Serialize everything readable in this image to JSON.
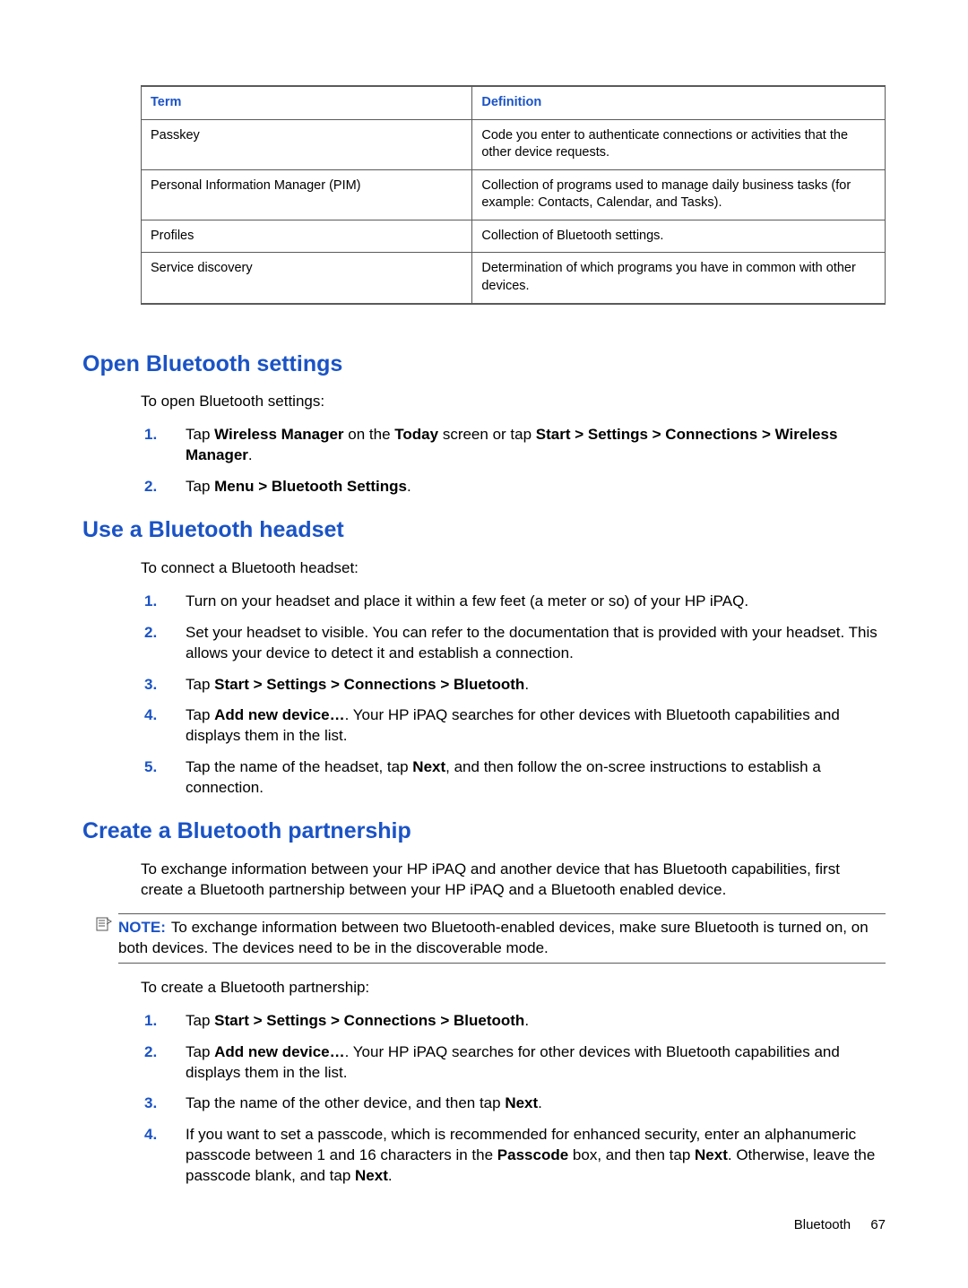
{
  "table": {
    "header_term": "Term",
    "header_definition": "Definition",
    "rows": [
      {
        "term": "Passkey",
        "def": "Code you enter to authenticate connections or activities that the other device requests."
      },
      {
        "term": "Personal Information Manager (PIM)",
        "def": "Collection of programs used to manage daily business tasks (for example: Contacts, Calendar, and Tasks)."
      },
      {
        "term": "Profiles",
        "def": "Collection of Bluetooth settings."
      },
      {
        "term": "Service discovery",
        "def": "Determination of which programs you have in common with other devices."
      }
    ]
  },
  "sec1": {
    "heading": "Open Bluetooth settings",
    "intro": "To open Bluetooth settings:",
    "items": [
      {
        "n": "1.",
        "pre": "Tap ",
        "b1": "Wireless Manager",
        "mid": " on the ",
        "b2": "Today",
        "mid2": " screen or tap ",
        "b3": "Start > Settings > Connections > Wireless Manager",
        "post": "."
      },
      {
        "n": "2.",
        "pre": "Tap ",
        "b1": "Menu > Bluetooth Settings",
        "post": "."
      }
    ]
  },
  "sec2": {
    "heading": "Use a Bluetooth headset",
    "intro": "To connect a Bluetooth headset:",
    "items": [
      {
        "n": "1.",
        "text": "Turn on your headset and place it within a few feet (a meter or so) of your HP iPAQ."
      },
      {
        "n": "2.",
        "text": "Set your headset to visible. You can refer to the documentation that is provided with your headset. This allows your device to detect it and establish a connection."
      },
      {
        "n": "3.",
        "pre": "Tap ",
        "b1": "Start > Settings > Connections > Bluetooth",
        "post": "."
      },
      {
        "n": "4.",
        "pre": "Tap ",
        "b1": "Add new device…",
        "post": ". Your HP iPAQ searches for other devices with Bluetooth capabilities and displays them in the list."
      },
      {
        "n": "5.",
        "pre": "Tap the name of the headset, tap ",
        "b1": "Next",
        "post": ", and then follow the on-scree instructions to establish a connection."
      }
    ]
  },
  "sec3": {
    "heading": "Create a Bluetooth partnership",
    "intro": "To exchange information between your HP iPAQ and another device that has Bluetooth capabilities, first create a Bluetooth partnership between your HP iPAQ and a Bluetooth enabled device.",
    "note_label": "NOTE:",
    "note_text": "To exchange information between two Bluetooth-enabled devices, make sure Bluetooth is turned on, on both devices. The devices need to be in the discoverable mode.",
    "intro2": "To create a Bluetooth partnership:",
    "items": [
      {
        "n": "1.",
        "pre": "Tap ",
        "b1": "Start > Settings > Connections > Bluetooth",
        "post": "."
      },
      {
        "n": "2.",
        "pre": "Tap ",
        "b1": "Add new device…",
        "post": ". Your HP iPAQ searches for other devices with Bluetooth capabilities and displays them in the list."
      },
      {
        "n": "3.",
        "pre": "Tap the name of the other device, and then tap ",
        "b1": "Next",
        "post": "."
      },
      {
        "n": "4.",
        "pre": "If you want to set a passcode, which is recommended for enhanced security, enter an alphanumeric passcode between 1 and 16 characters in the ",
        "b1": "Passcode",
        "mid": " box, and then tap ",
        "b2": "Next",
        "mid2": ". Otherwise, leave the passcode blank, and tap ",
        "b3": "Next",
        "post": "."
      }
    ]
  },
  "footer": {
    "section": "Bluetooth",
    "page": "67"
  }
}
